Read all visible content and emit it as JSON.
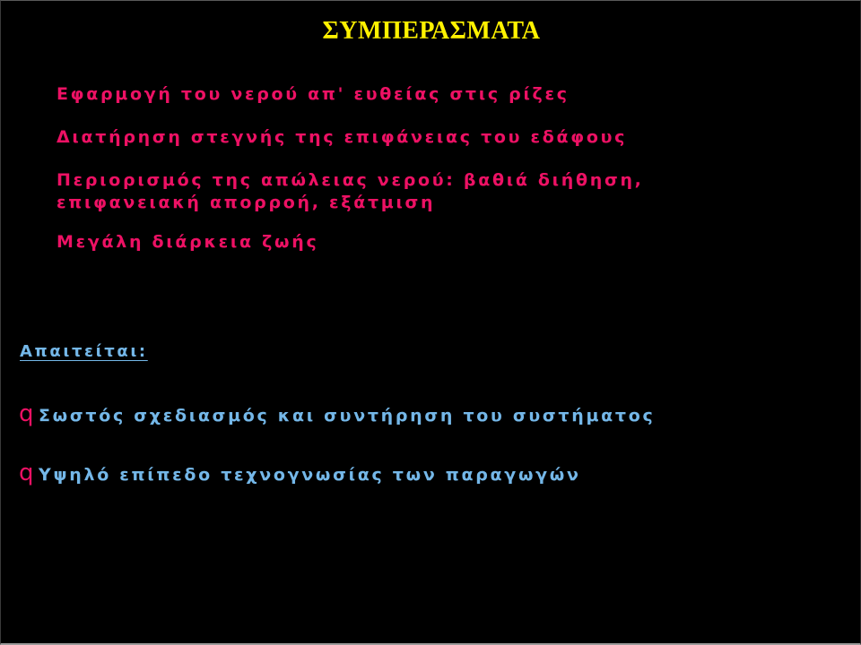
{
  "slide": {
    "background_color": "#000000",
    "title": "ΣΥΜΠΕΡΑΣΜΑΤΑ",
    "title_color": "#FFF200"
  },
  "body": {
    "text_color": "#ED1164",
    "lines": [
      "Εφαρμογή του νερού απ' ευθείας στις ρίζες",
      "Διατήρηση στεγνής της επιφάνειας του εδάφους",
      "Περιορισμός της απώλειας νερού: βαθιά διήθηση, επιφανειακή απορροή, εξάτμιση",
      "Μεγάλη διάρκεια ζωής"
    ]
  },
  "requirements": {
    "heading": "Απαιτείται:",
    "heading_color": "#74B7E8",
    "bullet_glyph": "q",
    "bullet_glyph_color": "#ED1164",
    "items": [
      "Σωστός σχεδιασμός και συντήρηση του συστήματος",
      "Υψηλό επίπεδο τεχνογνωσίας των παραγωγών"
    ],
    "item_color": "#74B7E8"
  }
}
